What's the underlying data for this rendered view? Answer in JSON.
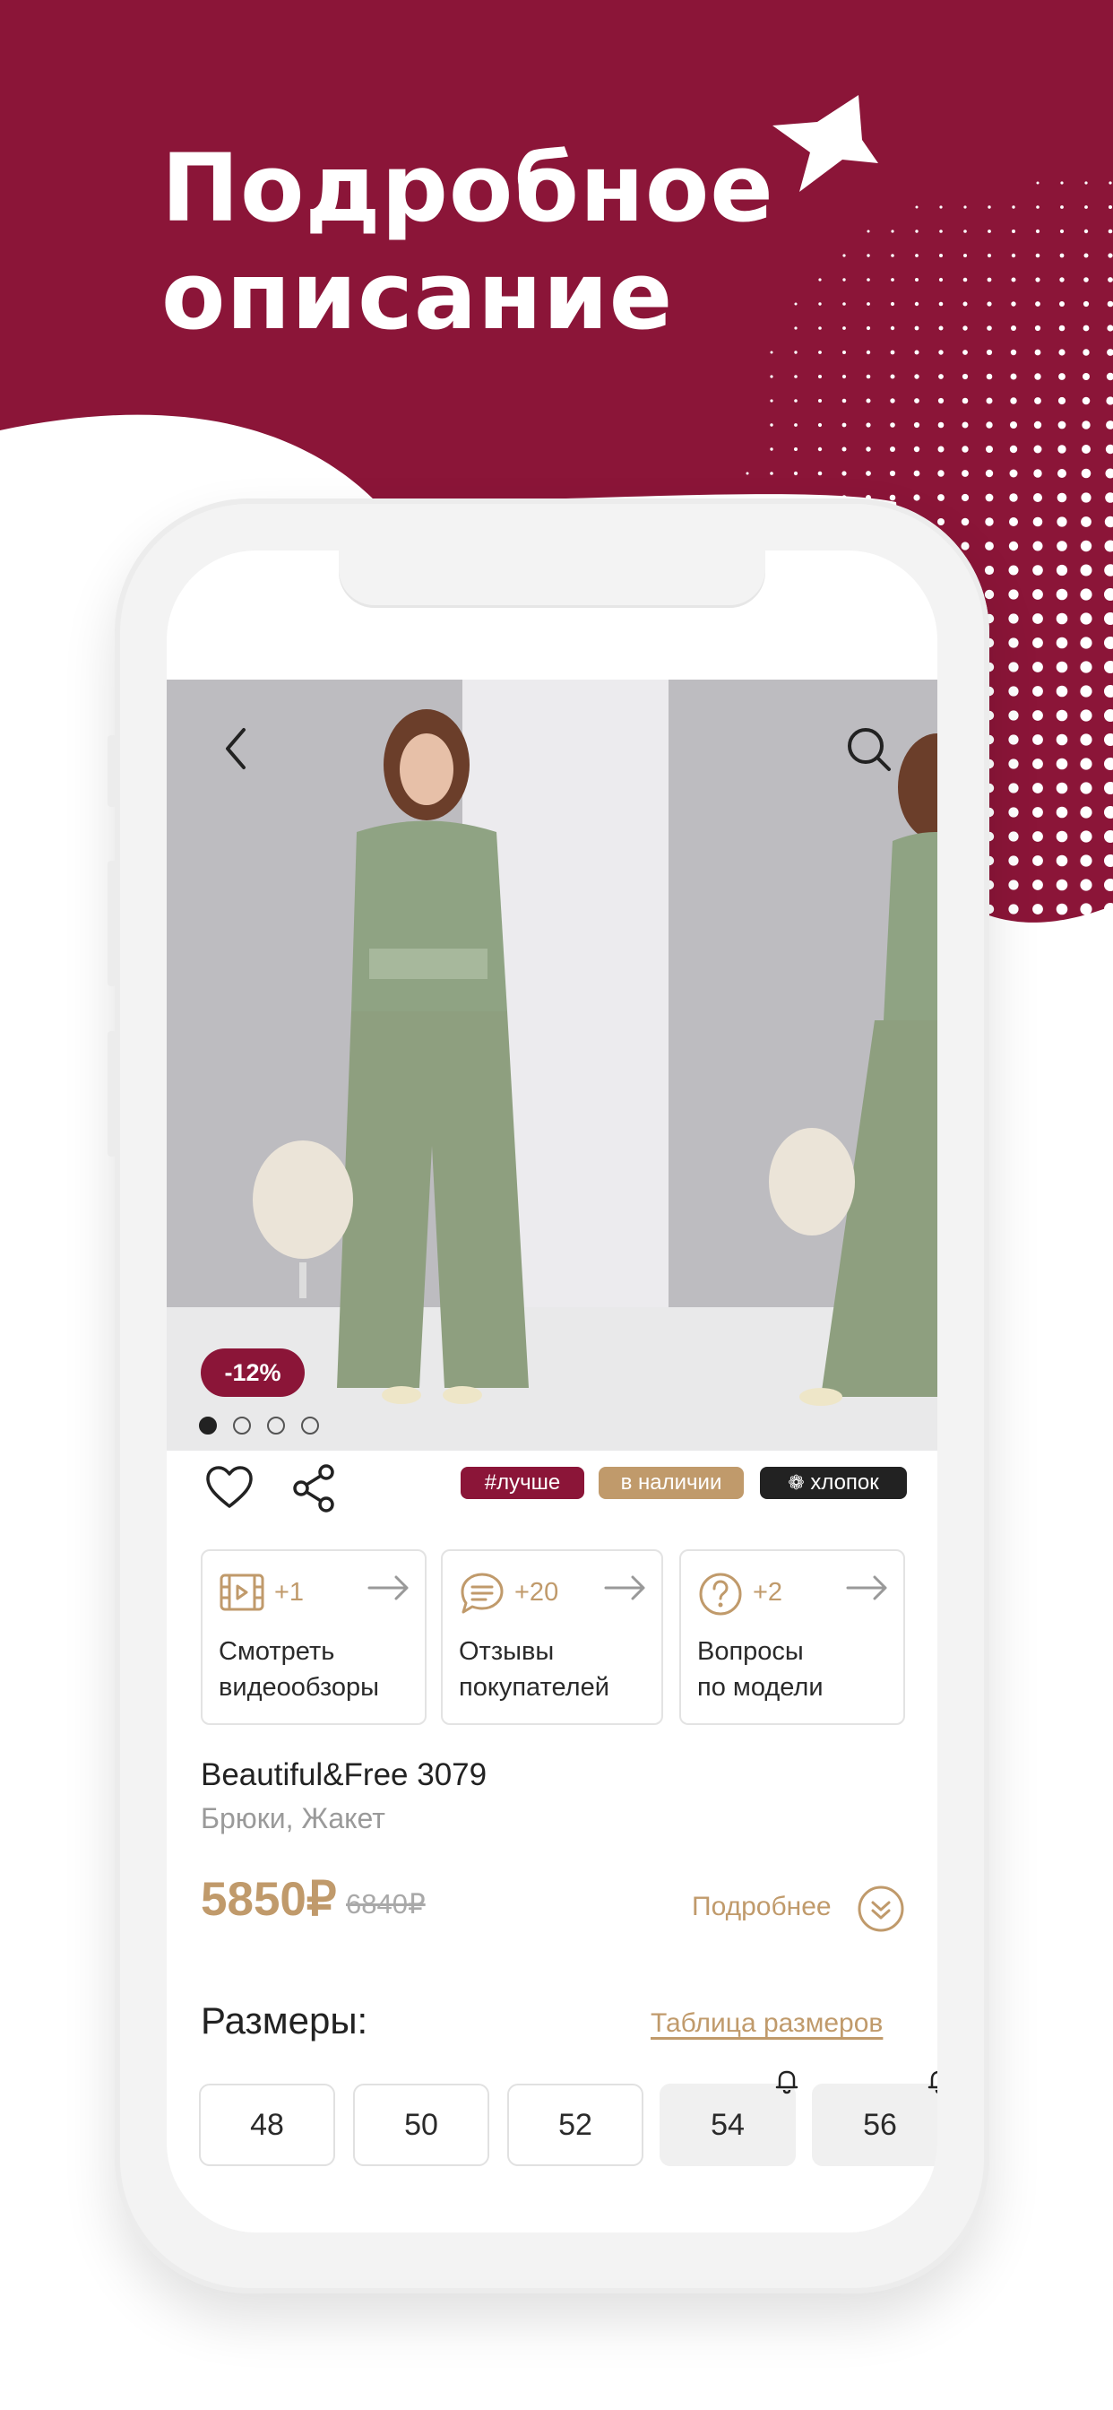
{
  "promo": {
    "headline_line1": "Подробное",
    "headline_line2": "описание",
    "accent_color": "#8b1538"
  },
  "product": {
    "discount_badge": "-12%",
    "gallery_count": 4,
    "gallery_active": 0,
    "tags": [
      {
        "label": "#лучше",
        "color": "#8b1538"
      },
      {
        "label": "в наличии",
        "color": "#c09a6b"
      },
      {
        "label": "хлопок",
        "color": "#222222"
      }
    ],
    "cards": [
      {
        "icon": "video-icon",
        "count": "+1",
        "label_line1": "Смотреть",
        "label_line2": "видеообзоры"
      },
      {
        "icon": "chat-icon",
        "count": "+20",
        "label_line1": "Отзывы",
        "label_line2": "покупателей"
      },
      {
        "icon": "question-icon",
        "count": "+2",
        "label_line1": "Вопросы",
        "label_line2": "по модели"
      }
    ],
    "brand": "Beautiful&Free 3079",
    "subtitle": "Брюки, Жакет",
    "price": "5850₽",
    "old_price": "6840₽",
    "details_link": "Подробнее",
    "sizes_title": "Размеры:",
    "size_table_link": "Таблица размеров",
    "sizes": [
      {
        "label": "48",
        "available": true
      },
      {
        "label": "50",
        "available": true
      },
      {
        "label": "52",
        "available": true
      },
      {
        "label": "54",
        "available": false
      },
      {
        "label": "56",
        "available": false
      }
    ]
  }
}
